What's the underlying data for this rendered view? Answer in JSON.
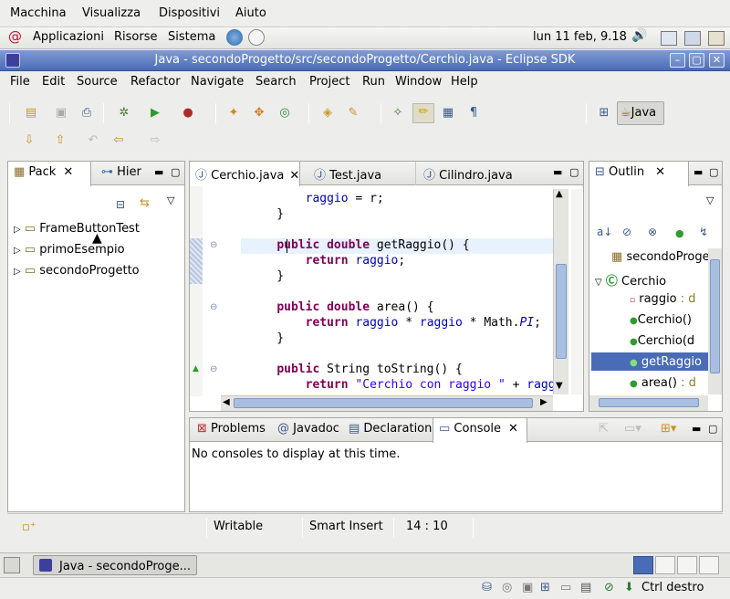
{
  "vbox_menu": [
    "Macchina",
    "Visualizza",
    "Dispositivi",
    "Aiuto"
  ],
  "gnome": {
    "apps": "Applicazioni",
    "places": "Risorse",
    "system": "Sistema",
    "clock": "lun 11 feb,  9.18"
  },
  "window": {
    "title": "Java - secondoProgetto/src/secondoProgetto/Cerchio.java - Eclipse SDK"
  },
  "menu": [
    "File",
    "Edit",
    "Source",
    "Refactor",
    "Navigate",
    "Search",
    "Project",
    "Run",
    "Window",
    "Help"
  ],
  "perspective": {
    "label": "Java"
  },
  "left_panel": {
    "tabs": [
      "Pack",
      "Hier"
    ],
    "projects": [
      "FrameButtonTest",
      "primoEsempio",
      "secondoProgetto"
    ]
  },
  "editor": {
    "tabs": [
      "Cerchio.java",
      "Test.java",
      "Cilindro.java"
    ],
    "lines": [
      {
        "parts": [
          {
            "t": "        "
          },
          {
            "t": "raggio",
            "c": "fld"
          },
          {
            "t": " = r;"
          }
        ]
      },
      {
        "parts": [
          {
            "t": "    }"
          }
        ]
      },
      {
        "parts": [
          {
            "t": ""
          }
        ]
      },
      {
        "parts": [
          {
            "t": "    "
          },
          {
            "t": "public",
            "c": "kw"
          },
          {
            "t": " "
          },
          {
            "t": "double",
            "c": "kw"
          },
          {
            "t": " getRaggio() {"
          }
        ]
      },
      {
        "parts": [
          {
            "t": "        "
          },
          {
            "t": "return",
            "c": "kw"
          },
          {
            "t": " "
          },
          {
            "t": "raggio",
            "c": "fld"
          },
          {
            "t": ";"
          }
        ]
      },
      {
        "parts": [
          {
            "t": "    }"
          }
        ]
      },
      {
        "parts": [
          {
            "t": ""
          }
        ]
      },
      {
        "parts": [
          {
            "t": "    "
          },
          {
            "t": "public",
            "c": "kw"
          },
          {
            "t": " "
          },
          {
            "t": "double",
            "c": "kw"
          },
          {
            "t": " area() {"
          }
        ]
      },
      {
        "parts": [
          {
            "t": "        "
          },
          {
            "t": "return",
            "c": "kw"
          },
          {
            "t": " "
          },
          {
            "t": "raggio",
            "c": "fld"
          },
          {
            "t": " * "
          },
          {
            "t": "raggio",
            "c": "fld"
          },
          {
            "t": " * Math."
          },
          {
            "t": "PI",
            "c": "ital"
          },
          {
            "t": ";"
          }
        ]
      },
      {
        "parts": [
          {
            "t": "    }"
          }
        ]
      },
      {
        "parts": [
          {
            "t": ""
          }
        ]
      },
      {
        "parts": [
          {
            "t": "    "
          },
          {
            "t": "public",
            "c": "kw"
          },
          {
            "t": " String toString() {"
          }
        ]
      },
      {
        "parts": [
          {
            "t": "        "
          },
          {
            "t": "return",
            "c": "kw"
          },
          {
            "t": " "
          },
          {
            "t": "\"Cerchio con raggio \"",
            "c": "str"
          },
          {
            "t": " + "
          },
          {
            "t": "raggio",
            "c": "fld"
          },
          {
            "t": ";"
          }
        ]
      }
    ]
  },
  "outline": {
    "tab": "Outlin",
    "items": [
      {
        "label": "secondoProge"
      },
      {
        "label": "Cerchio"
      },
      {
        "label": "raggio",
        "type": " : d"
      },
      {
        "label": "Cerchio()"
      },
      {
        "label": "Cerchio(d"
      },
      {
        "label": "getRaggio"
      },
      {
        "label": "area()",
        "type": " : d"
      }
    ]
  },
  "bottom": {
    "tabs": [
      "Problems",
      "Javadoc",
      "Declaration",
      "Console"
    ],
    "message": "No consoles to display at this time."
  },
  "status": {
    "writable": "Writable",
    "insert": "Smart Insert",
    "position": "14 : 10"
  },
  "taskbar": {
    "item": "Java - secondoProge..."
  },
  "vbox_status": {
    "host_key": "Ctrl destro"
  }
}
